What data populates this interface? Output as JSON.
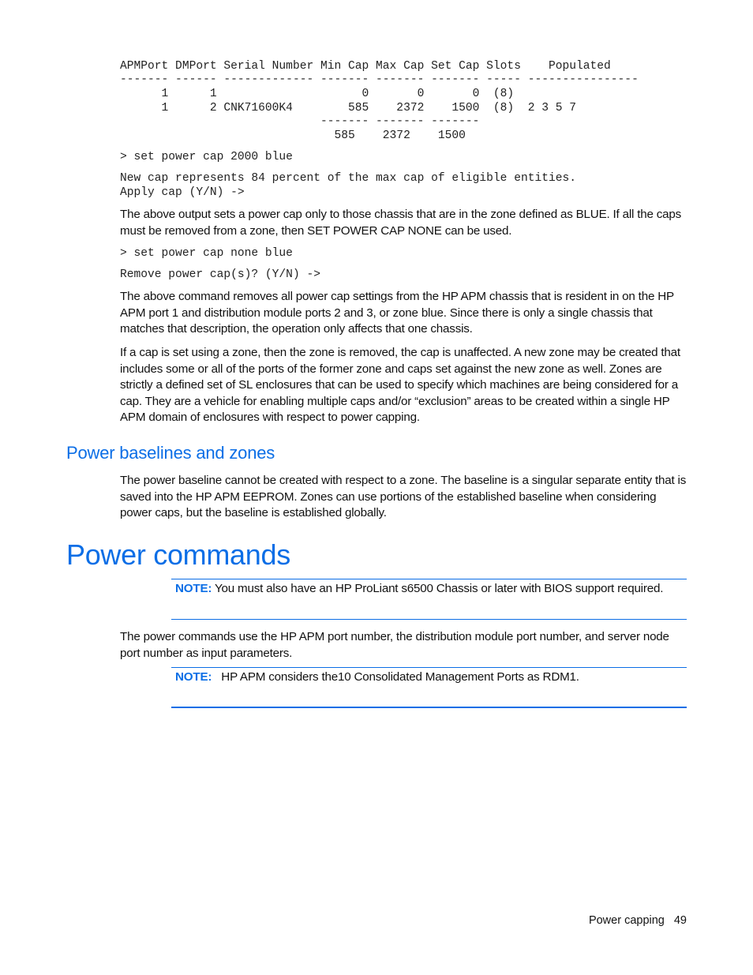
{
  "table": {
    "header": "APMPort DMPort Serial Number Min Cap Max Cap Set Cap Slots    Populated",
    "separator": "------- ------ ------------- ------- ------- ------- ----- ----------------",
    "columns": [
      "APMPort",
      "DMPort",
      "Serial Number",
      "Min Cap",
      "Max Cap",
      "Set Cap",
      "Slots",
      "Populated"
    ],
    "rows": [
      {
        "apm_port": "1",
        "dm_port": "1",
        "serial": "",
        "min_cap": "0",
        "max_cap": "0",
        "set_cap": "0",
        "slots": "(8)",
        "populated": "",
        "line": "      1      1                     0       0       0  (8)"
      },
      {
        "apm_port": "1",
        "dm_port": "2",
        "serial": "CNK71600K4",
        "min_cap": "585",
        "max_cap": "2372",
        "set_cap": "1500",
        "slots": "(8)",
        "populated": "2 3 5 7",
        "line": "      1      2 CNK71600K4        585    2372    1500  (8)  2 3 5 7"
      }
    ],
    "total_separator": "                             ------- ------- -------",
    "totals": {
      "min_cap": "585",
      "max_cap": "2372",
      "set_cap": "1500",
      "line": "                               585    2372    1500"
    }
  },
  "commands": {
    "set_cap": "> set power cap 2000 blue",
    "set_cap_response": "New cap represents 84 percent of the max cap of eligible entities.\nApply cap (Y/N) ->",
    "remove_cap": "> set power cap none blue",
    "remove_cap_response": "Remove power cap(s)? (Y/N) ->"
  },
  "paragraphs": {
    "p1": "The above output sets a power cap only to those chassis that are in the zone defined as BLUE. If all the caps must be removed from a zone, then SET POWER CAP NONE can be used.",
    "p2": "The above command removes all power cap settings from the HP APM chassis that is resident in on the HP APM port 1 and distribution module ports 2 and 3, or zone blue. Since there is only a single chassis that matches that description, the operation only affects that one chassis.",
    "p3": "If a cap is set using a zone, then the zone is removed, the cap is unaffected. A new zone may be created that includes some or all of the ports of the former zone and caps set against the new zone as well. Zones are strictly a defined set of SL enclosures that can be used to specify which machines are being considered for a cap. They are a vehicle for enabling multiple caps and/or “exclusion” areas to be created within a single HP APM domain of enclosures with respect to power capping."
  },
  "section_baselines": {
    "heading": "Power baselines and zones",
    "text": "The power baseline cannot be created with respect to a zone. The baseline is a singular separate entity that is saved into the HP APM EEPROM. Zones can use portions of the established baseline when considering power caps, but the baseline is established globally."
  },
  "section_commands": {
    "heading": "Power commands",
    "note1": {
      "label": "NOTE:",
      "text": " You must also have an HP ProLiant s6500 Chassis or later with BIOS support required."
    },
    "text": "The power commands use the HP APM port number, the distribution module port number, and server node port number as input parameters.",
    "note2": {
      "label": "NOTE:",
      "text": "   HP APM considers the10 Consolidated Management Ports as RDM1."
    }
  },
  "footer": {
    "section": "Power capping",
    "page": "49"
  },
  "colors": {
    "accent": "#0b6ee6",
    "text": "#111111"
  }
}
